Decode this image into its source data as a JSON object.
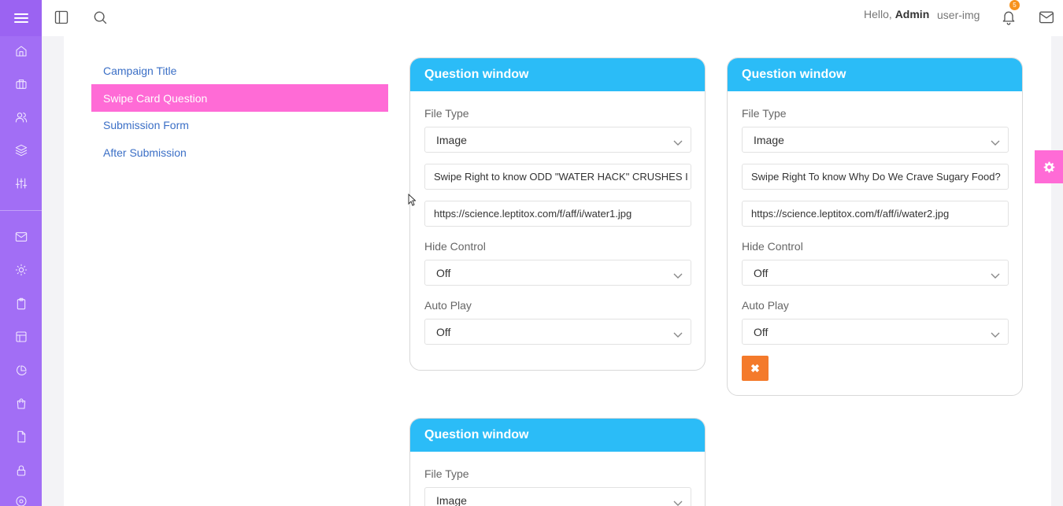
{
  "topbar": {
    "greeting": "Hello,",
    "user_name": "Admin",
    "user_img_alt": "user-img",
    "notification_count": "5"
  },
  "nav": {
    "items": [
      "Campaign Title",
      "Swipe Card Question",
      "Submission Form",
      "After Submission"
    ],
    "active": "Swipe Card Question"
  },
  "cards": [
    {
      "header": "Question window",
      "file_type_label": "File Type",
      "file_type_value": "Image",
      "question_text": "Swipe Right to know ODD \"WATER HACK\" CRUSHES I",
      "image_url": "https://science.leptitox.com/f/aff/i/water1.jpg",
      "hide_control_label": "Hide Control",
      "hide_control_value": "Off",
      "auto_play_label": "Auto Play",
      "auto_play_value": "Off"
    },
    {
      "header": "Question window",
      "file_type_label": "File Type",
      "file_type_value": "Image",
      "question_text": "Swipe Right To know Why Do We Crave Sugary Food?",
      "image_url": "https://science.leptitox.com/f/aff/i/water2.jpg",
      "hide_control_label": "Hide Control",
      "hide_control_value": "Off",
      "auto_play_label": "Auto Play",
      "auto_play_value": "Off",
      "delete_label": "✖"
    },
    {
      "header": "Question window",
      "file_type_label": "File Type",
      "file_type_value": "Image"
    }
  ],
  "colors": {
    "sidebar": "#a26ef5",
    "accent_pink": "#ff6bd6",
    "card_header": "#2bbcf7",
    "delete_button": "#f47a2b"
  },
  "icons": {
    "sidebar": [
      "menu-icon",
      "home-icon",
      "briefcase-icon",
      "users-icon",
      "layers-icon",
      "sliders-icon",
      "mail-icon",
      "sun-icon",
      "clipboard-icon",
      "layout-icon",
      "pie-chart-icon",
      "shopping-bag-icon",
      "file-icon",
      "lock-icon",
      "disc-icon"
    ],
    "topbar": [
      "sidebar-toggle-icon",
      "search-icon",
      "bell-icon",
      "mail-icon"
    ],
    "settings": "gear-icon"
  }
}
